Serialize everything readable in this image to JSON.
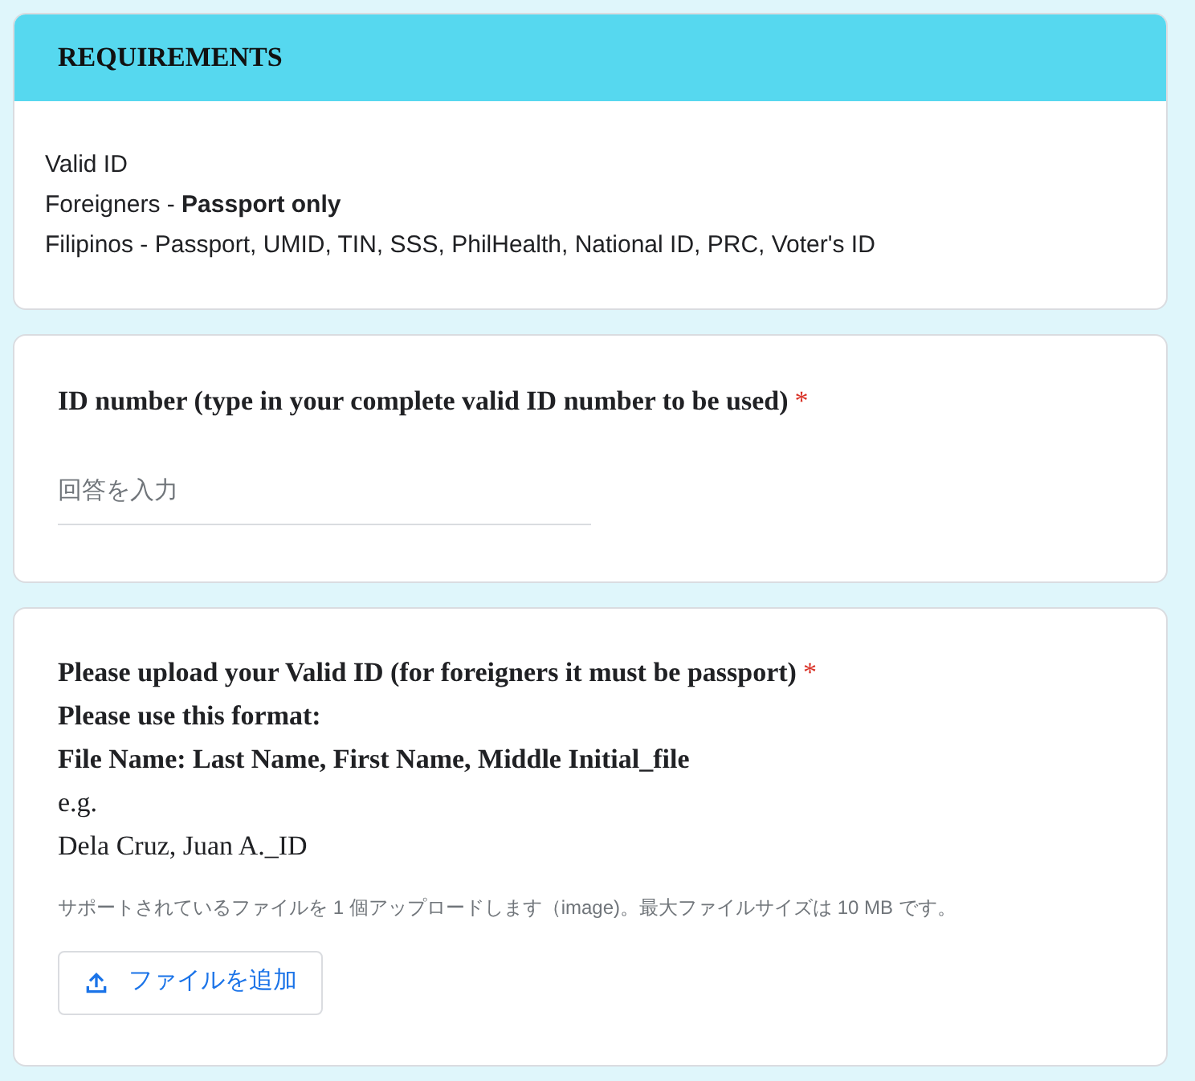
{
  "section": {
    "title": "REQUIREMENTS",
    "lines": [
      "Valid ID",
      "Foreigners - **Passport only**",
      "Filipinos - Passport, UMID, TIN, SSS, PhilHealth, National ID, PRC, Voter's ID"
    ]
  },
  "questions": [
    {
      "kind": "text",
      "lines": [
        {
          "text": "ID number (type in your complete valid ID number to be used)",
          "bold": true,
          "required_mark": "*"
        }
      ],
      "placeholder": "回答を入力"
    },
    {
      "kind": "file",
      "lines": [
        {
          "text": "Please upload your Valid ID (for foreigners it must be passport)",
          "bold": true,
          "required_mark": "*"
        },
        {
          "text": "Please use this format:",
          "bold": true
        },
        {
          "text": "File Name: Last Name, First Name, Middle Initial_file",
          "bold": true
        },
        {
          "text": "e.g.",
          "bold": false
        },
        {
          "text": "Dela Cruz, Juan A._ID",
          "bold": false
        }
      ],
      "hint": "サポートされているファイルを 1 個アップロードします（image)。最大ファイルサイズは 10 MB です。",
      "button": "ファイルを追加"
    }
  ]
}
